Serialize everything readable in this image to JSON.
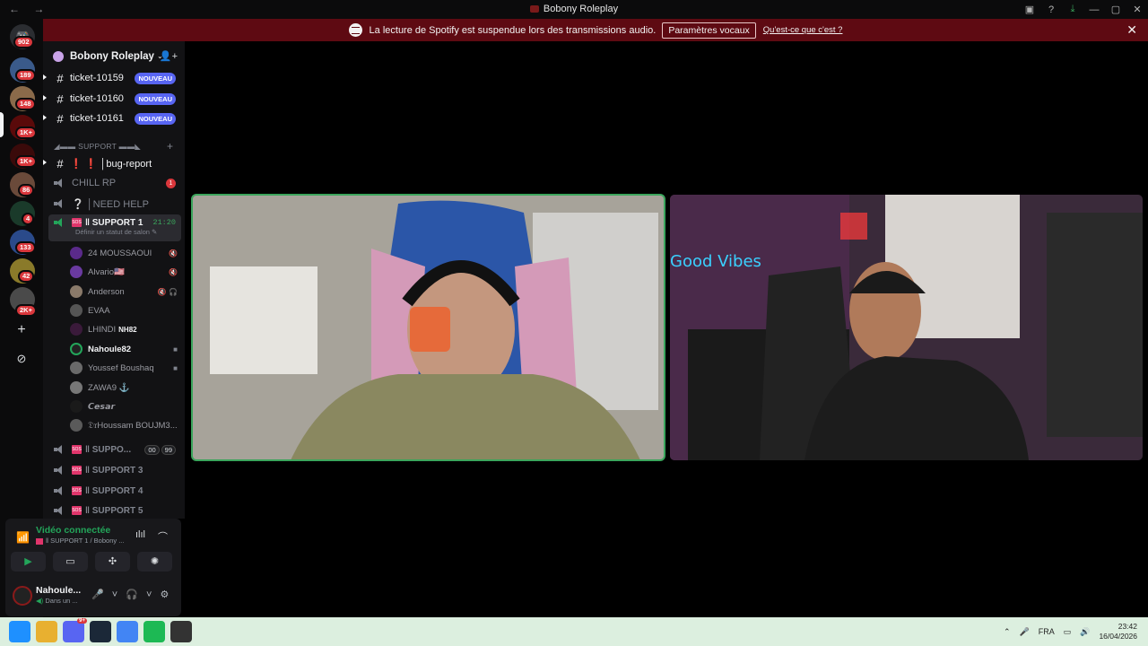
{
  "window": {
    "title": "Bobony Roleplay",
    "nav": "← →"
  },
  "banner": {
    "message": "La lecture de Spotify est suspendue lors des transmissions audio.",
    "button": "Paramètres vocaux",
    "link": "Qu'est-ce que c'est ?",
    "close": "✕"
  },
  "rail": {
    "badges": [
      "902",
      "189",
      "148",
      "1K+",
      "1K+",
      "86",
      "4",
      "133",
      "42",
      "2K+"
    ],
    "add": "+",
    "explore": "⊘"
  },
  "guild": {
    "name": "Bobony Roleplay",
    "chevron": "⌄",
    "invite": "👤+"
  },
  "channels": {
    "tickets": [
      {
        "name": "ticket-10159",
        "tag": "NOUVEAU"
      },
      {
        "name": "ticket-10160",
        "tag": "NOUVEAU"
      },
      {
        "name": "ticket-10161",
        "tag": "NOUVEAU"
      }
    ],
    "category": "◢▬▬ SUPPORT ▬▬◣",
    "category_plus": "+",
    "bug_report": "❗ ❗ │bug-report",
    "chill": {
      "name": "CHILL RP",
      "mention": "1"
    },
    "need_help": "❔ │NEED HELP",
    "support1": {
      "name": "‖ SUPPORT 1",
      "timer": "21:20",
      "status": "Définir un statut de salon ✎"
    },
    "users": [
      {
        "name": "24 MOUSSAOUI",
        "icon": "🔇"
      },
      {
        "name": "Alvario🇺🇸",
        "icon": "🔇"
      },
      {
        "name": "Anderson",
        "icon": "🔇 🎧"
      },
      {
        "name": "EVAA",
        "icon": ""
      },
      {
        "name": "LHINDI",
        "tag": "NH82",
        "icon": ""
      },
      {
        "name": "Nahoule82",
        "icon": "■"
      },
      {
        "name": "Youssef Boushaq",
        "icon": "■"
      },
      {
        "name": "ZAWA9 ⚓",
        "icon": ""
      },
      {
        "name": "𝘾𝙚𝙨𝙖𝙧",
        "icon": ""
      },
      {
        "name": "𝔇𝔯Houssam BOUJM3...",
        "icon": ""
      }
    ],
    "support2": {
      "name": "‖ SUPPO...",
      "a": "00",
      "b": "99"
    },
    "support3": "‖ SUPPORT 3",
    "support4": "‖ SUPPORT 4",
    "support5": "‖ SUPPORT 5"
  },
  "voice": {
    "title": "Vidéo connectée",
    "subtitle": "‖ SUPPORT 1 / Bobony ...",
    "buttons": [
      "▶",
      "▭",
      "✣",
      "✺"
    ]
  },
  "user": {
    "name": "Nahoule...",
    "status": "Dans un ...",
    "controls": "🎤 ˅ 🎧 ˅ ⚙"
  },
  "taskbar": {
    "lang": "FRA",
    "time": "23:42",
    "date": "16/04/2026",
    "chat_badge": "9+"
  },
  "colors": {
    "banner": "#5e0a12",
    "accent": "#5865f2",
    "voice_green": "#23a55a",
    "badge_red": "#da373c"
  }
}
